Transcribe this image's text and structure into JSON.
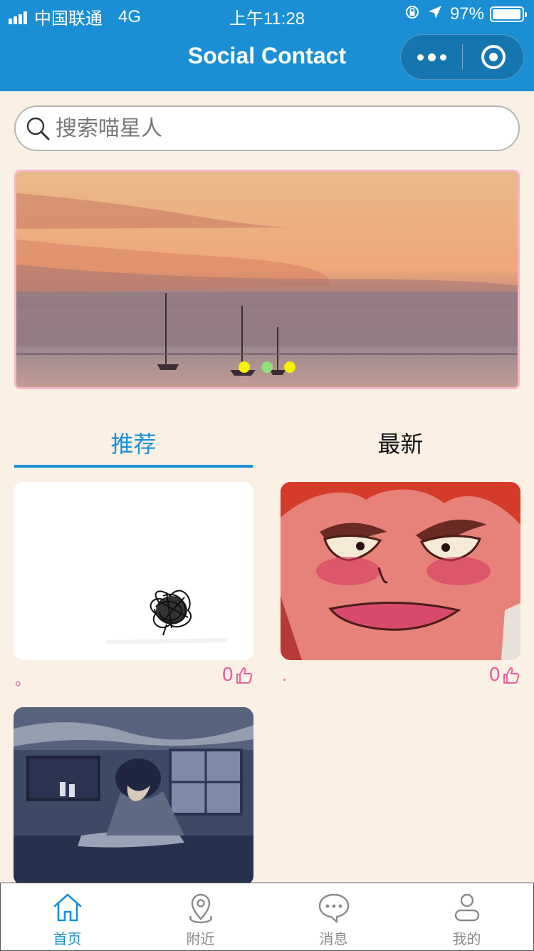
{
  "status_bar": {
    "carrier": "中国联通",
    "network": "4G",
    "time": "上午11:28",
    "battery": "97%",
    "battery_level": 0.97
  },
  "nav": {
    "title": "Social Contact"
  },
  "search": {
    "placeholder": "搜索喵星人"
  },
  "banner": {
    "slide_count": 3,
    "active_index": 1
  },
  "tabs": [
    {
      "label": "推荐",
      "active": true
    },
    {
      "label": "最新",
      "active": false
    }
  ],
  "posts": [
    {
      "title": "。",
      "likes": "0",
      "image": "ink-scribble"
    },
    {
      "title": ".",
      "likes": "0",
      "image": "anime-face"
    },
    {
      "title": "",
      "likes": "",
      "image": "anime-room"
    }
  ],
  "tabbar": [
    {
      "label": "首页",
      "icon": "home-icon",
      "active": true
    },
    {
      "label": "附近",
      "icon": "location-icon",
      "active": false
    },
    {
      "label": "消息",
      "icon": "message-icon",
      "active": false
    },
    {
      "label": "我的",
      "icon": "user-icon",
      "active": false
    }
  ],
  "colors": {
    "primary": "#1a8fd6",
    "background": "#faf1e4",
    "like": "#e8609f",
    "banner_border": "#f7b6c6",
    "dot": "#f5f200",
    "dot_active": "#8ee07a"
  }
}
